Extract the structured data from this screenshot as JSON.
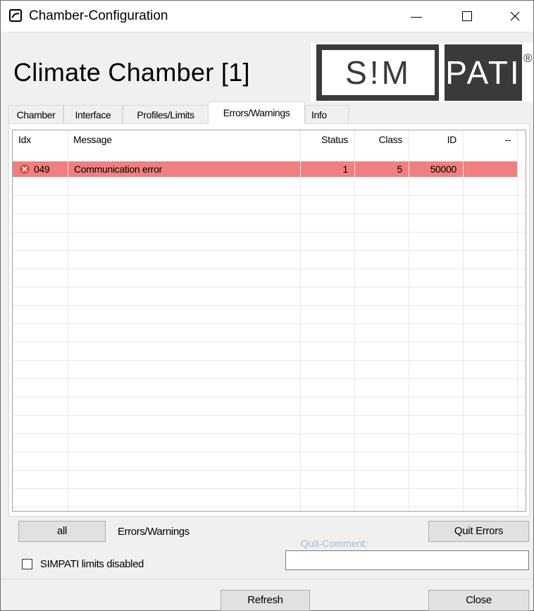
{
  "window": {
    "title": "Chamber-Configuration"
  },
  "header": {
    "title": "Climate Chamber [1]",
    "logo": {
      "part1": "S!M",
      "part2": "PATI",
      "reg": "®"
    }
  },
  "tabs": [
    {
      "label": "Chamber",
      "active": false
    },
    {
      "label": "Interface",
      "active": false
    },
    {
      "label": "Profiles/Limits",
      "active": false
    },
    {
      "label": "Errors/Warnings",
      "active": true
    },
    {
      "label": "Info",
      "active": false
    }
  ],
  "table": {
    "columns": [
      "Idx",
      "Message",
      "Status",
      "Class",
      "ID",
      "--"
    ],
    "rows": [
      {
        "icon": "error-icon",
        "idx": "049",
        "message": "Communication error",
        "status": "1",
        "class": "5",
        "id": "50000",
        "extra": ""
      }
    ],
    "row_highlight_color": "#f08080"
  },
  "controls": {
    "all_button": "all",
    "errors_warnings_label": "Errors/Warnings",
    "quit_errors_button": "Quit Errors",
    "quit_comment_label": "Quit-Comment:",
    "quit_comment_value": "",
    "limits_checkbox_label": "SIMPATI limits disabled",
    "limits_checkbox_checked": false,
    "refresh_button": "Refresh",
    "close_button": "Close"
  }
}
